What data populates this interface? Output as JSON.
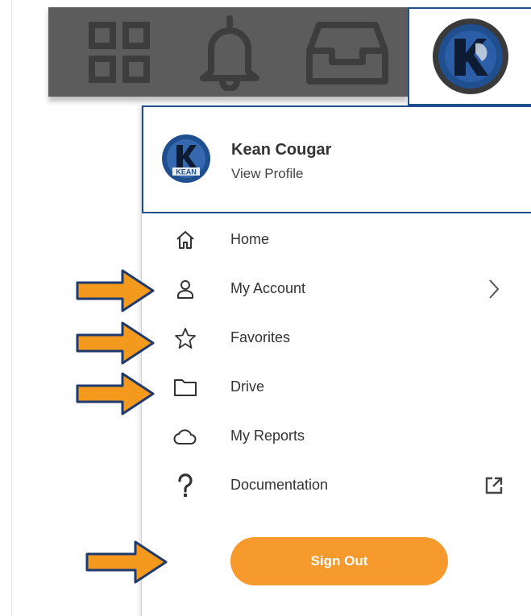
{
  "colors": {
    "accent": "#f79a2e",
    "brand_blue": "#1f4f8f",
    "topbar": "#5c5c5c",
    "annotation_arrow": "#f39a1e"
  },
  "topbar": {
    "icons": [
      "apps-grid-icon",
      "bell-icon",
      "inbox-icon",
      "avatar-icon"
    ]
  },
  "profile": {
    "name": "Kean Cougar",
    "link": "View Profile",
    "avatar_text": "KEAN"
  },
  "menu": {
    "items": [
      {
        "label": "Home",
        "icon": "home-icon"
      },
      {
        "label": "My Account",
        "icon": "person-icon",
        "trailing": "chevron-right-icon"
      },
      {
        "label": "Favorites",
        "icon": "star-icon"
      },
      {
        "label": "Drive",
        "icon": "folder-icon"
      },
      {
        "label": "My Reports",
        "icon": "cloud-icon"
      },
      {
        "label": "Documentation",
        "icon": "question-icon",
        "trailing": "external-link-icon"
      }
    ],
    "sign_out": "Sign Out"
  },
  "annotations": {
    "arrows": [
      "my-account",
      "favorites",
      "drive",
      "sign-out"
    ]
  }
}
